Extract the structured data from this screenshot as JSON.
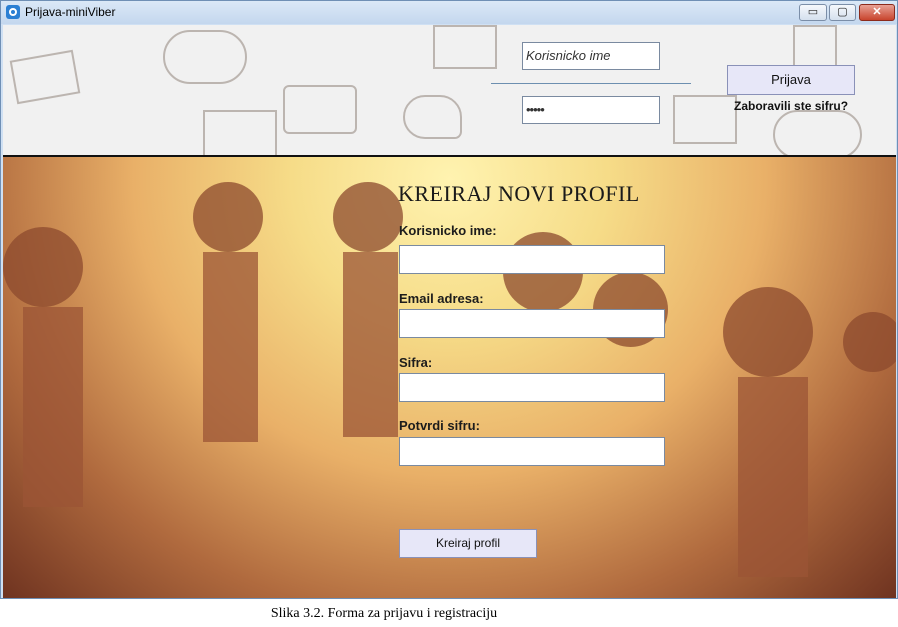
{
  "window": {
    "title": "Prijava-miniViber",
    "controls": {
      "minimize": "▭",
      "maximize": "▢",
      "close": "✕"
    }
  },
  "login": {
    "username_value": "Korisnicko ime",
    "password_value": "•••••",
    "login_button": "Prijava",
    "forgot_link": "Zaboravili ste sifru?"
  },
  "register": {
    "title": "KREIRAJ NOVI PROFIL",
    "username_label": "Korisnicko ime:",
    "email_label": "Email adresa:",
    "password_label": "Sifra:",
    "confirm_label": "Potvrdi sifru:",
    "submit_button": "Kreiraj profil"
  },
  "caption": "Slika 3.2. Forma za prijavu i registraciju",
  "colors": {
    "button_bg": "#e7e7f8",
    "header_bg": "#f1f1f1",
    "accent": "#2b7fd3"
  }
}
